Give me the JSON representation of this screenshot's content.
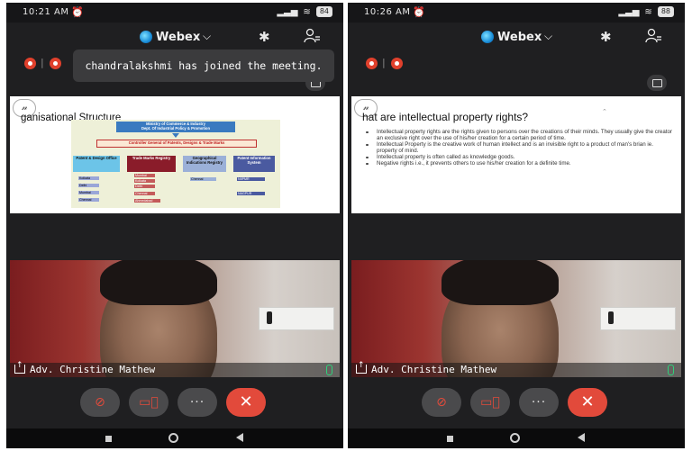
{
  "left": {
    "status": {
      "time": "10:21 AM",
      "battery": "84"
    },
    "app": {
      "name": "Webex"
    },
    "toast": "chandralakshmi has joined the meeting.",
    "slide": {
      "badge": "𝓃",
      "title": "ganisational Structure",
      "org": {
        "top": "Ministry of Commerce & Industry\nDept. Of Industrial Policy & Promotion",
        "controller": "Controller General of Patents, Designs & Trade Marks",
        "columns": [
          "Patent & Design Office",
          "Trade Marks Registry",
          "Geographical Indications Registry",
          "Patent Information System"
        ],
        "patent_offices": [
          "Kolkata",
          "Delhi",
          "Mumbai",
          "Chennai"
        ],
        "tm_offices": [
          "Mumbai",
          "Kolkata",
          "Delhi",
          "Chennai",
          "Ahmedabad"
        ],
        "gi_offices": [
          "Chennai"
        ],
        "pis_offices": [
          "NIIPMR",
          "NAGPUR"
        ]
      }
    },
    "participant": "Adv. Christine Mathew"
  },
  "right": {
    "status": {
      "time": "10:26 AM",
      "battery": "88"
    },
    "app": {
      "name": "Webex"
    },
    "slide": {
      "badge": "𝓃",
      "title": "hat are intellectual property rights?",
      "bullets": [
        "Intellectual property rights are the rights given to persons over the creations of their minds. They usually give the creator an exclusive right over the use of his/her creation for a certain period of time.",
        "Intellectual Property is the creative work of human intellect and is an invisible right to a product  of man's brian ie. property of mind.",
        "Intellectual property is often called as knowledge goods.",
        "Negative rights i.e., it prevents others to use his/her creation for a definite time."
      ]
    },
    "participant": "Adv. Christine Mathew"
  },
  "colors": {
    "accent_red": "#e24a3b",
    "mic_green": "#2fd07a",
    "bg": "#1f1f21"
  },
  "icons": [
    "alarm-icon",
    "signal-icon",
    "wifi-icon",
    "battery-icon",
    "bluetooth-icon",
    "participants-icon",
    "record-icon",
    "layout-icon",
    "share-icon",
    "mute-mic-icon",
    "stop-video-icon",
    "more-icon",
    "end-call-icon"
  ],
  "controls": {
    "more": "···",
    "end": "✕"
  }
}
